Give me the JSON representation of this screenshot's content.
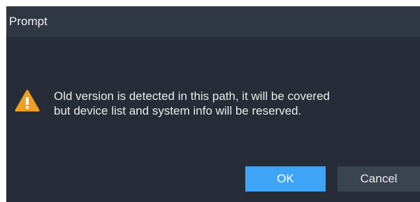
{
  "dialog": {
    "title": "Prompt",
    "icon": "warning-icon",
    "message_line1": "Old version is detected in this path, it will be covered",
    "message_line2": "but device list and system info will be reserved.",
    "ok_label": "OK",
    "cancel_label": "Cancel"
  },
  "colors": {
    "background": "#262d38",
    "titlebar": "#2f3743",
    "primary_button": "#3ea4f6",
    "secondary_button": "#3a4350",
    "warning": "#f0a020"
  }
}
